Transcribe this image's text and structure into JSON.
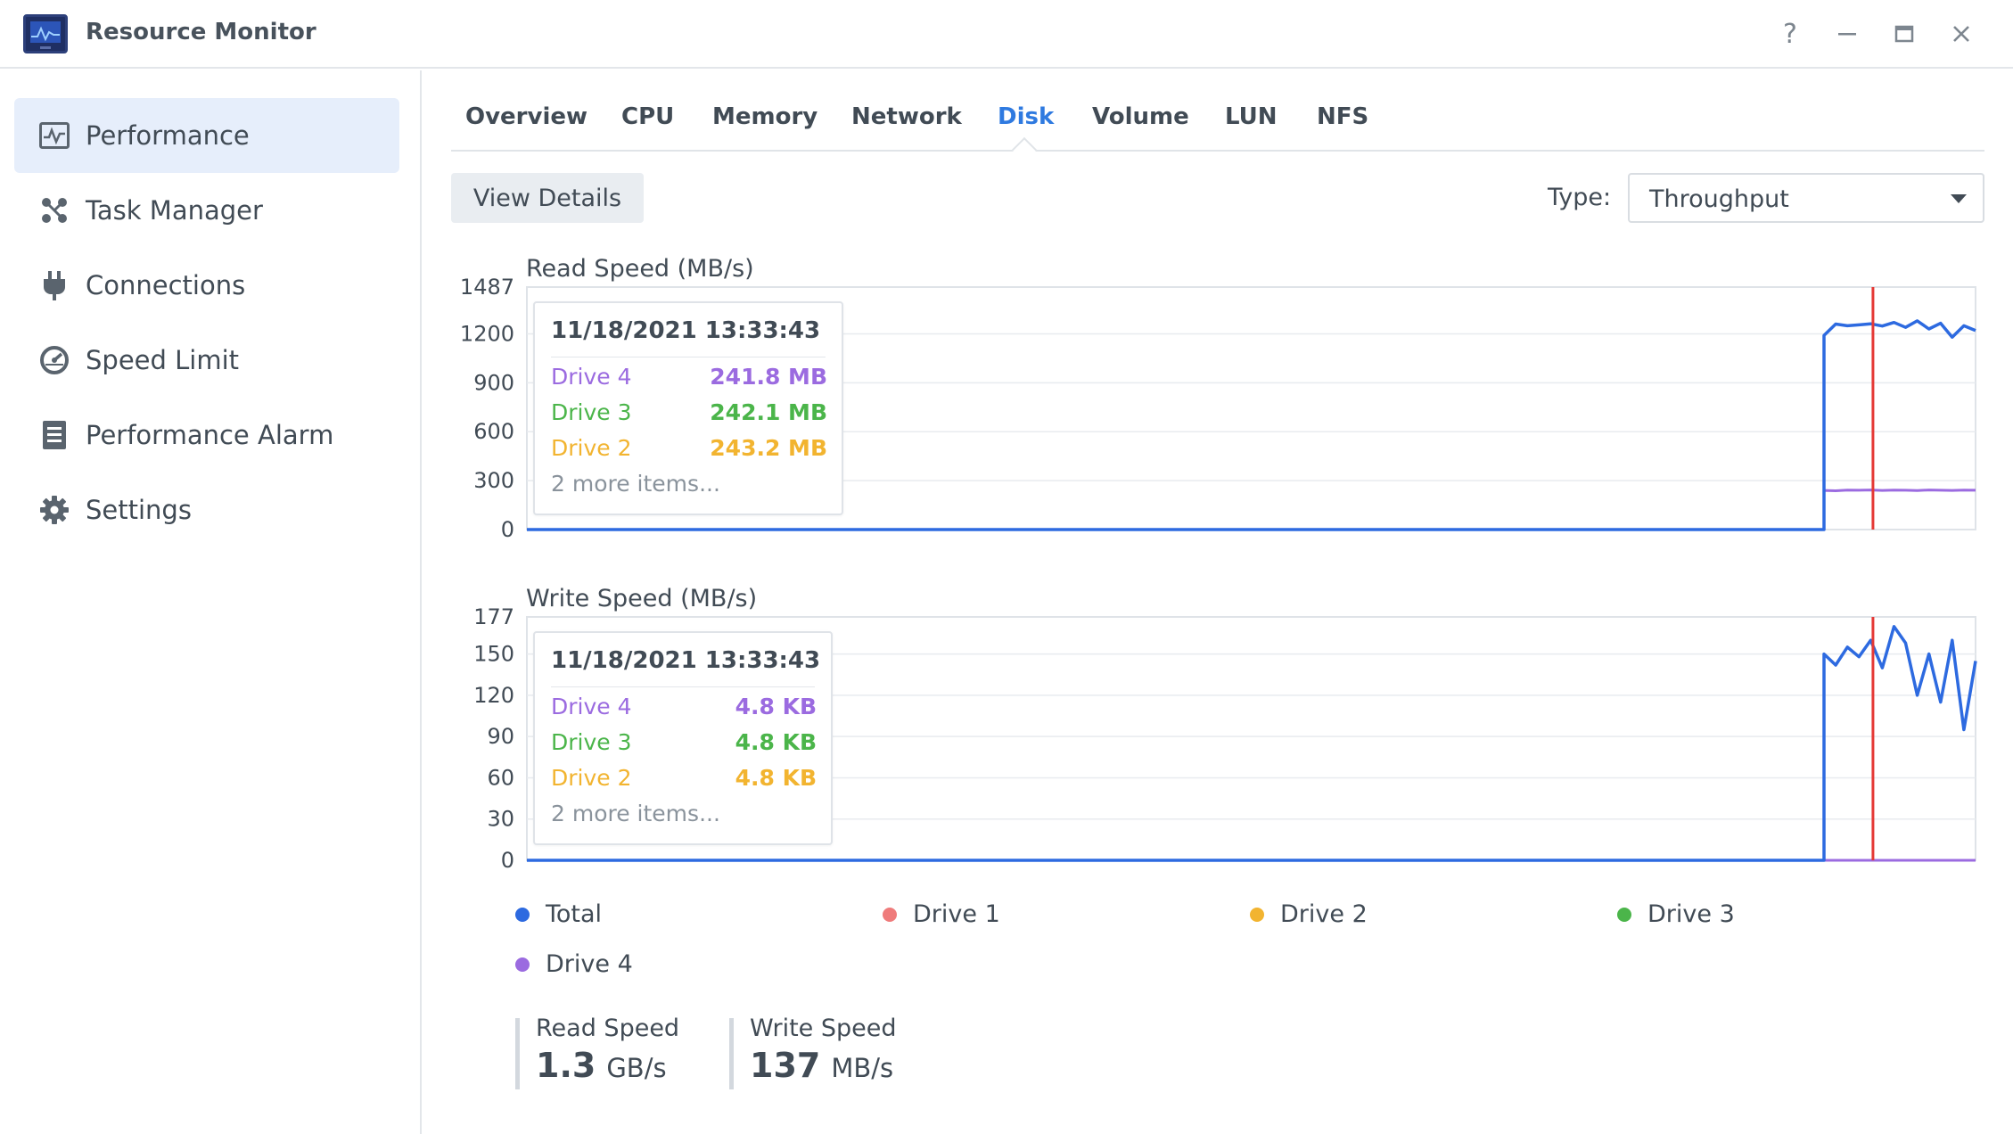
{
  "window": {
    "title": "Resource Monitor"
  },
  "sidebar": {
    "items": [
      {
        "label": "Performance",
        "icon": "performance-icon",
        "active": true
      },
      {
        "label": "Task Manager",
        "icon": "task-manager-icon"
      },
      {
        "label": "Connections",
        "icon": "plug-icon"
      },
      {
        "label": "Speed Limit",
        "icon": "speedometer-icon"
      },
      {
        "label": "Performance Alarm",
        "icon": "alarm-list-icon"
      },
      {
        "label": "Settings",
        "icon": "gear-icon"
      }
    ]
  },
  "tabs": [
    {
      "label": "Overview"
    },
    {
      "label": "CPU"
    },
    {
      "label": "Memory"
    },
    {
      "label": "Network"
    },
    {
      "label": "Disk",
      "active": true
    },
    {
      "label": "Volume"
    },
    {
      "label": "LUN"
    },
    {
      "label": "NFS"
    }
  ],
  "toolbar": {
    "view_details": "View Details",
    "type_label": "Type:",
    "type_value": "Throughput"
  },
  "colors": {
    "accent": "#2f7ae0",
    "total": "#2d6ae0",
    "drive1": "#ef7b7b",
    "drive2": "#f2b430",
    "drive3": "#4bb54a",
    "drive4": "#9b6be0",
    "cursor": "#e53935"
  },
  "read_tooltip": {
    "time": "11/18/2021 13:33:43",
    "rows": [
      {
        "name": "Drive 4",
        "value": "241.8 MB",
        "color": "#9b6be0"
      },
      {
        "name": "Drive 3",
        "value": "242.1 MB",
        "color": "#4bb54a"
      },
      {
        "name": "Drive 2",
        "value": "243.2 MB",
        "color": "#f2b430"
      }
    ],
    "more": "2 more items..."
  },
  "write_tooltip": {
    "time": "11/18/2021 13:33:43",
    "rows": [
      {
        "name": "Drive 4",
        "value": "4.8 KB",
        "color": "#9b6be0"
      },
      {
        "name": "Drive 3",
        "value": "4.8 KB",
        "color": "#4bb54a"
      },
      {
        "name": "Drive 2",
        "value": "4.8 KB",
        "color": "#f2b430"
      }
    ],
    "more": "2 more items..."
  },
  "legend": [
    {
      "name": "Total",
      "color": "#2d6ae0"
    },
    {
      "name": "Drive 1",
      "color": "#ef7b7b"
    },
    {
      "name": "Drive 2",
      "color": "#f2b430"
    },
    {
      "name": "Drive 3",
      "color": "#4bb54a"
    },
    {
      "name": "Drive 4",
      "color": "#9b6be0"
    }
  ],
  "summary": {
    "read": {
      "label": "Read Speed",
      "value": "1.3",
      "unit": "GB/s"
    },
    "write": {
      "label": "Write Speed",
      "value": "137",
      "unit": "MB/s"
    }
  },
  "chart_data": [
    {
      "type": "line",
      "title": "Read Speed (MB/s)",
      "ylim": [
        0,
        1487
      ],
      "yticks": [
        "0",
        "300",
        "600",
        "900",
        "1200",
        "1487"
      ],
      "ytick_values": [
        0,
        300,
        600,
        900,
        1200,
        1487
      ],
      "x_samples": 60,
      "cursor_index": 52,
      "series": [
        {
          "name": "Total",
          "color": "#2d6ae0",
          "values": [
            0,
            0,
            0,
            0,
            0,
            0,
            0,
            0,
            0,
            0,
            0,
            0,
            0,
            0,
            0,
            0,
            0,
            0,
            0,
            0,
            0,
            0,
            0,
            0,
            0,
            0,
            0,
            0,
            0,
            0,
            0,
            0,
            0,
            0,
            0,
            0,
            0,
            0,
            0,
            0,
            0,
            0,
            0,
            0,
            0,
            0,
            1190,
            1260,
            1250,
            1255,
            1262,
            1248,
            1270,
            1240,
            1280,
            1230,
            1265,
            1180,
            1250,
            1220
          ]
        },
        {
          "name": "Drive 4",
          "color": "#9b6be0",
          "values": [
            0,
            0,
            0,
            0,
            0,
            0,
            0,
            0,
            0,
            0,
            0,
            0,
            0,
            0,
            0,
            0,
            0,
            0,
            0,
            0,
            0,
            0,
            0,
            0,
            0,
            0,
            0,
            0,
            0,
            0,
            0,
            0,
            0,
            0,
            0,
            0,
            0,
            0,
            0,
            0,
            0,
            0,
            0,
            0,
            0,
            0,
            240,
            238,
            242,
            241,
            243,
            240,
            242,
            241,
            239,
            243,
            241,
            240,
            242,
            241
          ]
        }
      ]
    },
    {
      "type": "line",
      "title": "Write Speed (MB/s)",
      "ylim": [
        0,
        177
      ],
      "yticks": [
        "0",
        "30",
        "60",
        "90",
        "120",
        "150",
        "177"
      ],
      "ytick_values": [
        0,
        30,
        60,
        90,
        120,
        150,
        177
      ],
      "x_samples": 60,
      "cursor_index": 52,
      "series": [
        {
          "name": "Total",
          "color": "#2d6ae0",
          "values": [
            0,
            0,
            0,
            0,
            0,
            0,
            0,
            0,
            0,
            0,
            0,
            0,
            0,
            0,
            0,
            0,
            0,
            0,
            0,
            0,
            0,
            0,
            0,
            0,
            0,
            0,
            0,
            0,
            0,
            0,
            0,
            0,
            0,
            0,
            0,
            0,
            0,
            0,
            0,
            0,
            0,
            0,
            0,
            0,
            0,
            0,
            150,
            142,
            155,
            148,
            160,
            140,
            170,
            158,
            120,
            150,
            115,
            160,
            95,
            145
          ]
        },
        {
          "name": "Drive 4",
          "color": "#9b6be0",
          "values": [
            0,
            0,
            0,
            0,
            0,
            0,
            0,
            0,
            0,
            0,
            0,
            0,
            0,
            0,
            0,
            0,
            0,
            0,
            0,
            0,
            0,
            0,
            0,
            0,
            0,
            0,
            0,
            0,
            0,
            0,
            0,
            0,
            0,
            0,
            0,
            0,
            0,
            0,
            0,
            0,
            0,
            0,
            0,
            0,
            0,
            0,
            0,
            0,
            0,
            0,
            0,
            0,
            0,
            0,
            0,
            0,
            0,
            0,
            0,
            0
          ]
        }
      ]
    }
  ]
}
